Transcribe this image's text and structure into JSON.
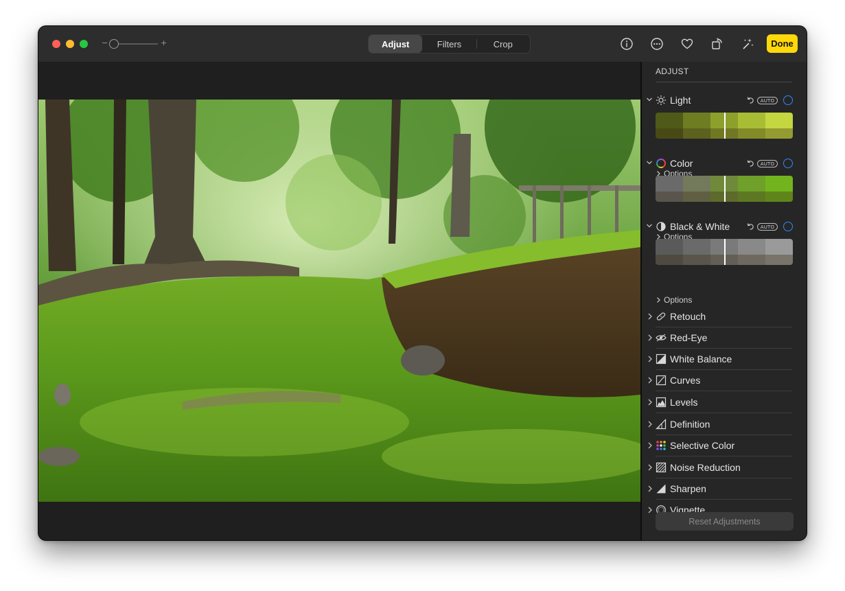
{
  "toolbar": {
    "tabs": [
      {
        "label": "Adjust",
        "active": true
      },
      {
        "label": "Filters",
        "active": false
      },
      {
        "label": "Crop",
        "active": false
      }
    ],
    "zoom_minus": "−",
    "zoom_plus": "+",
    "zoom_level": 0.05,
    "icons": [
      "info-icon",
      "more-icon",
      "heart-icon",
      "rotate-icon",
      "magic-wand-icon"
    ],
    "done_label": "Done",
    "done_color": "#fed80a"
  },
  "sidebar": {
    "heading": "ADJUST",
    "auto_label": "AUTO",
    "options_label": "Options",
    "accent_color": "#2f89ff",
    "sections": [
      {
        "label": "Light",
        "icon": "sun-icon"
      },
      {
        "label": "Color",
        "icon": "color-wheel-icon"
      },
      {
        "label": "Black & White",
        "icon": "half-circle-icon"
      }
    ],
    "tools": [
      {
        "label": "Retouch",
        "icon": "bandage-icon"
      },
      {
        "label": "Red-Eye",
        "icon": "eye-icon"
      },
      {
        "label": "White Balance",
        "icon": "white-balance-icon"
      },
      {
        "label": "Curves",
        "icon": "curves-icon"
      },
      {
        "label": "Levels",
        "icon": "levels-icon"
      },
      {
        "label": "Definition",
        "icon": "definition-icon"
      },
      {
        "label": "Selective Color",
        "icon": "selective-color-icon"
      },
      {
        "label": "Noise Reduction",
        "icon": "noise-reduction-icon"
      },
      {
        "label": "Sharpen",
        "icon": "sharpen-icon"
      },
      {
        "label": "Vignette",
        "icon": "vignette-icon"
      }
    ],
    "reset_label": "Reset Adjustments"
  }
}
